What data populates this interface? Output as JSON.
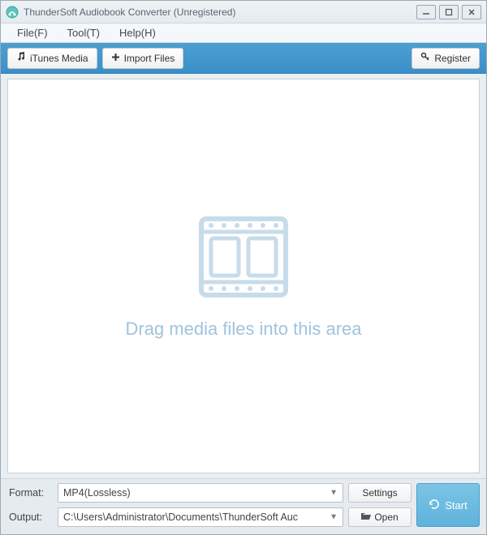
{
  "titlebar": {
    "title": "ThunderSoft Audiobook Converter (Unregistered)"
  },
  "menu": {
    "file": "File(F)",
    "tool": "Tool(T)",
    "help": "Help(H)"
  },
  "toolbar": {
    "itunes_media": "iTunes Media",
    "import_files": "Import Files",
    "register": "Register"
  },
  "main": {
    "drop_text": "Drag media files into this area"
  },
  "bottom": {
    "format_label": "Format:",
    "format_value": "MP4(Lossless)",
    "output_label": "Output:",
    "output_value": "C:\\Users\\Administrator\\Documents\\ThunderSoft Auc",
    "settings": "Settings",
    "open": "Open",
    "start": "Start"
  }
}
